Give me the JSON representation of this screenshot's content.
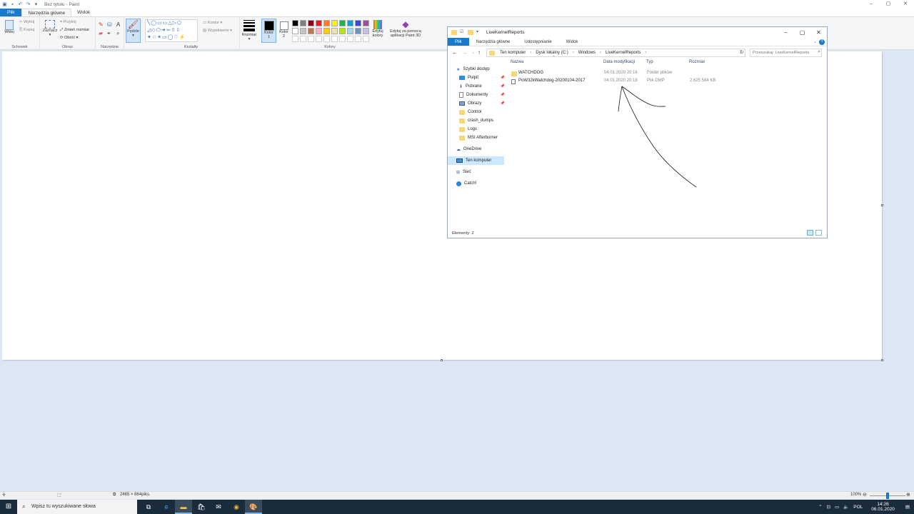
{
  "paint": {
    "title": "Bez tytułu - Paint",
    "tabs": [
      "Plik",
      "Narzędzia główne",
      "Widok"
    ],
    "groups": {
      "clipboard": {
        "label": "Schowek",
        "paste": "Wklej",
        "cut": "Wytnij",
        "copy": "Kopiuj"
      },
      "image": {
        "label": "Obraz",
        "select": "Zaznacz",
        "crop": "Przytnij",
        "resize": "Zmień rozmiar",
        "rotate": "Obróć"
      },
      "tools": {
        "label": "Narzędzia"
      },
      "brushes": {
        "label": "Pędzle"
      },
      "shapes": {
        "label": "Kształty",
        "outline": "Kontur",
        "fill": "Wypełnienie"
      },
      "size": {
        "label": "Rozmiar"
      },
      "color1": {
        "label": "Kolor 1",
        "value": "#000000"
      },
      "color2": {
        "label": "Kolor 2",
        "value": "#ffffff"
      },
      "colors": {
        "label": "Kolory"
      },
      "edit_colors": {
        "label": "Edytuj kolory"
      },
      "paint3d": {
        "label": "Edytuj za pomocą aplikacji Paint 3D"
      }
    },
    "palette_row1": [
      "#000000",
      "#7f7f7f",
      "#880015",
      "#ed1c24",
      "#ff7f27",
      "#fff200",
      "#22b14c",
      "#00a2e8",
      "#3f48cc",
      "#a349a4"
    ],
    "palette_row2": [
      "#ffffff",
      "#c3c3c3",
      "#b97a57",
      "#ffaec9",
      "#ffc90e",
      "#efe4b0",
      "#b5e61d",
      "#99d9ea",
      "#7092be",
      "#c8bfe7"
    ],
    "status": {
      "dimensions": "2465 × 864piks.",
      "zoom": "100%"
    }
  },
  "explorer": {
    "title": "LiveKernelReports",
    "tabs": [
      "Plik",
      "Narzędzia główne",
      "Udostępnianie",
      "Widok"
    ],
    "breadcrumb": [
      "Ten komputer",
      "Dysk lokalny (C:)",
      "Windows",
      "LiveKernelReports"
    ],
    "search_placeholder": "Przeszukaj: LiveKernelReports",
    "nav": [
      {
        "label": "Szybki dostęp",
        "icon": "star-icon"
      },
      {
        "label": "Pulpit",
        "icon": "desktop-icon"
      },
      {
        "label": "Pobrane",
        "icon": "download-icon"
      },
      {
        "label": "Dokumenty",
        "icon": "document-icon"
      },
      {
        "label": "Obrazy",
        "icon": "image-icon"
      },
      {
        "label": "Control",
        "icon": "folder-icon"
      },
      {
        "label": "crash_dumps",
        "icon": "folder-icon"
      },
      {
        "label": "Logs",
        "icon": "folder-icon"
      },
      {
        "label": "MSI Afterburner",
        "icon": "folder-icon"
      },
      {
        "label": "OneDrive",
        "icon": "cloud-icon"
      },
      {
        "label": "Ten komputer",
        "icon": "computer-icon"
      },
      {
        "label": "Sieć",
        "icon": "network-icon"
      },
      {
        "label": "Catch!",
        "icon": "catch-icon"
      }
    ],
    "columns": {
      "name": "Nazwa",
      "modified": "Data modyfikacji",
      "type": "Typ",
      "size": "Rozmiar"
    },
    "rows": [
      {
        "name": "WATCHDOG",
        "modified": "04.01.2020 20:16",
        "type": "Folder plików",
        "size": ""
      },
      {
        "name": "PoW32kWatchdog-20200104-2017",
        "modified": "04.01.2020 20:18",
        "type": "Plik DMP",
        "size": "2 625 584 KB"
      }
    ],
    "status": "Elementy: 2"
  },
  "taskbar": {
    "search_placeholder": "Wpisz tu wyszukiwane słowa",
    "language": "POL",
    "time": "14:26",
    "date": "06.01.2020"
  }
}
